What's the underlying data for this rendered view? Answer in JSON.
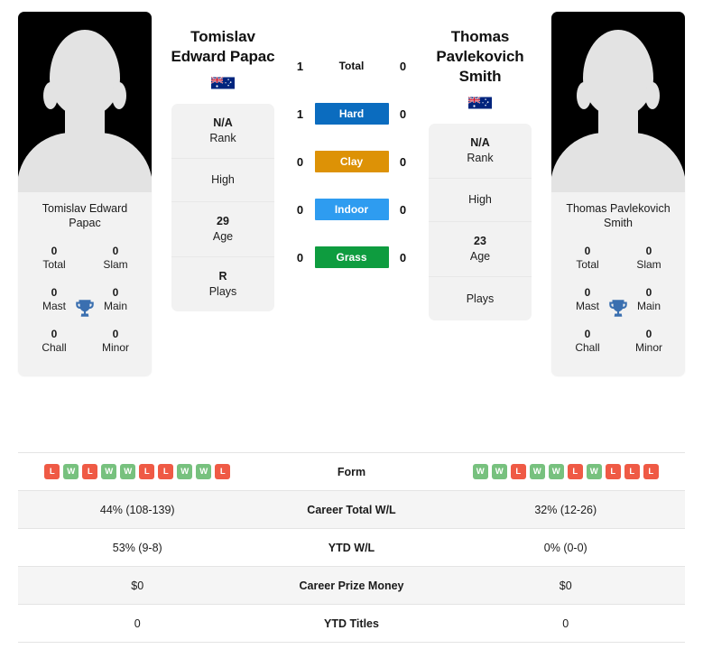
{
  "players": {
    "left": {
      "display_name_line1": "Tomislav",
      "display_name_line2": "Edward Papac",
      "card_name": "Tomislav Edward Papac",
      "flag": "australia-flag",
      "titles": [
        {
          "value": "0",
          "label": "Total"
        },
        {
          "value": "0",
          "label": "Slam"
        },
        {
          "value": "0",
          "label": "Mast"
        },
        {
          "value": "0",
          "label": "Main"
        },
        {
          "value": "0",
          "label": "Chall"
        },
        {
          "value": "0",
          "label": "Minor"
        }
      ],
      "info": [
        {
          "value": "N/A",
          "label": "Rank"
        },
        {
          "value": "",
          "label": "High"
        },
        {
          "value": "29",
          "label": "Age"
        },
        {
          "value": "R",
          "label": "Plays"
        }
      ],
      "form": [
        "L",
        "W",
        "L",
        "W",
        "W",
        "L",
        "L",
        "W",
        "W",
        "L"
      ],
      "career_total_wl": "44% (108-139)",
      "ytd_wl": "53% (9-8)",
      "career_prize_money": "$0",
      "ytd_titles": "0"
    },
    "right": {
      "display_name_line1": "Thomas",
      "display_name_line2": "Pavlekovich",
      "display_name_line3": "Smith",
      "card_name": "Thomas Pavlekovich Smith",
      "flag": "australia-flag",
      "titles": [
        {
          "value": "0",
          "label": "Total"
        },
        {
          "value": "0",
          "label": "Slam"
        },
        {
          "value": "0",
          "label": "Mast"
        },
        {
          "value": "0",
          "label": "Main"
        },
        {
          "value": "0",
          "label": "Chall"
        },
        {
          "value": "0",
          "label": "Minor"
        }
      ],
      "info": [
        {
          "value": "N/A",
          "label": "Rank"
        },
        {
          "value": "",
          "label": "High"
        },
        {
          "value": "23",
          "label": "Age"
        },
        {
          "value": "",
          "label": "Plays"
        }
      ],
      "form": [
        "W",
        "W",
        "L",
        "W",
        "W",
        "L",
        "W",
        "L",
        "L",
        "L"
      ],
      "career_total_wl": "32% (12-26)",
      "ytd_wl": "0% (0-0)",
      "career_prize_money": "$0",
      "ytd_titles": "0"
    }
  },
  "head_to_head": {
    "rows": [
      {
        "label": "Total",
        "left": "1",
        "right": "0",
        "color": "",
        "style": "plain"
      },
      {
        "label": "Hard",
        "left": "1",
        "right": "0",
        "color": "#0b6cbf",
        "style": "bar"
      },
      {
        "label": "Clay",
        "left": "0",
        "right": "0",
        "color": "#dd9206",
        "style": "bar"
      },
      {
        "label": "Indoor",
        "left": "0",
        "right": "0",
        "color": "#2e9cf0",
        "style": "bar"
      },
      {
        "label": "Grass",
        "left": "0",
        "right": "0",
        "color": "#0e9c3f",
        "style": "bar"
      }
    ]
  },
  "stats_table": {
    "rows": [
      {
        "key": "form",
        "label": "Form",
        "type": "form"
      },
      {
        "key": "ctwl",
        "label": "Career Total W/L",
        "type": "text",
        "left": "44% (108-139)",
        "right": "32% (12-26)"
      },
      {
        "key": "ytdwl",
        "label": "YTD W/L",
        "type": "text",
        "left": "53% (9-8)",
        "right": "0% (0-0)"
      },
      {
        "key": "prize",
        "label": "Career Prize Money",
        "type": "text",
        "left": "$0",
        "right": "$0"
      },
      {
        "key": "titles",
        "label": "YTD Titles",
        "type": "text",
        "left": "0",
        "right": "0"
      }
    ]
  },
  "colors": {
    "win": "#77c17e",
    "loss": "#ef5a45",
    "card_bg": "#f2f2f2",
    "row_alt": "#f5f5f5"
  }
}
